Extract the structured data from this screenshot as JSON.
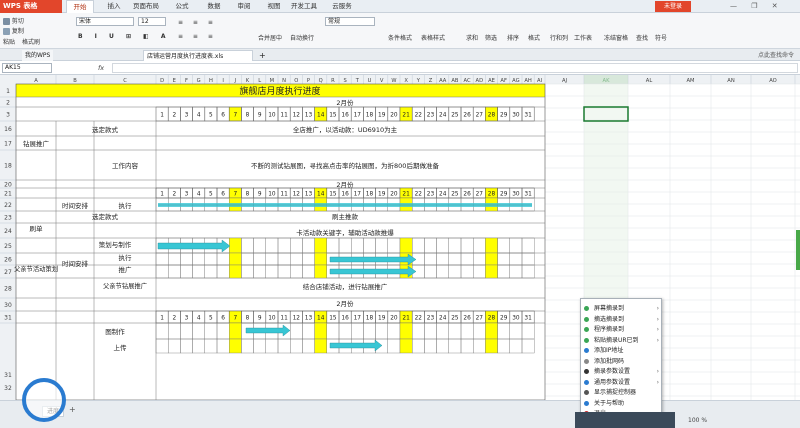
{
  "app": {
    "logo": "WPS 表格",
    "login": "未登录"
  },
  "menu_tabs": [
    "开始",
    "插入",
    "页面布局",
    "公式",
    "数据",
    "审阅",
    "视图",
    "开发工具",
    "云服务"
  ],
  "ribbon": {
    "cut": "剪切",
    "copy": "复制",
    "paste": "粘贴",
    "format_painter": "格式刷",
    "font": "宋体",
    "size": "12",
    "number_format": "常规",
    "merge": "合并居中",
    "wrap": "自动换行",
    "cond": "条件格式",
    "table_style": "表格样式",
    "sum": "求和",
    "filter": "筛选",
    "sort": "排序",
    "format": "格式",
    "rowcol": "行和列",
    "sheet": "工作表",
    "freeze": "冻结窗格",
    "find": "查找",
    "symbol": "符号"
  },
  "doctabs": {
    "home": "我的WPS",
    "file": "店铺运营月度执行进度表.xls",
    "hint": "点此查找命令"
  },
  "namebox": "AK15",
  "fx": "fx",
  "columns": [
    "A",
    "B",
    "C",
    "D",
    "E",
    "F",
    "G",
    "H",
    "I",
    "J",
    "K",
    "L",
    "M",
    "N",
    "O",
    "P",
    "Q",
    "R",
    "S",
    "T",
    "U",
    "V",
    "W",
    "X",
    "Y",
    "Z",
    "AA",
    "AB",
    "AC",
    "AD",
    "AE",
    "AF",
    "AG",
    "AH",
    "AI",
    "AJ",
    "AK",
    "AL",
    "AM",
    "AN",
    "AO"
  ],
  "rows": [
    "1",
    "2",
    "3",
    "16",
    "17",
    "18",
    "20",
    "21",
    "22",
    "23",
    "24",
    "25",
    "26",
    "27",
    "28",
    "30",
    "31",
    "32"
  ],
  "sheet": {
    "title": "旗舰店月度执行进度",
    "month": "2月份",
    "days": [
      "1",
      "2",
      "3",
      "4",
      "5",
      "6",
      "7",
      "8",
      "9",
      "10",
      "11",
      "12",
      "13",
      "14",
      "15",
      "16",
      "17",
      "18",
      "19",
      "20",
      "21",
      "22",
      "23",
      "24",
      "25",
      "26",
      "27",
      "28",
      "29",
      "30",
      "31"
    ],
    "highlight_days": [
      7,
      14,
      21,
      28
    ],
    "drill": "钻展推广",
    "select_style": "选定款式",
    "full_store": "全店推广，以活动款：UD6910为主",
    "work_content": "工作内容",
    "work_text": "不断的测试钻展图，寻找高点击率的钻展图，为折800后期做准备",
    "time_plan": "时间安排",
    "execute": "执行",
    "brush": "刷单",
    "brush_main": "刷主推款",
    "keyword": "卡活动款关键字，辅助活动款推爆",
    "plan_make": "策划与制作",
    "fathers": "父亲节活动策划",
    "exec2": "执行",
    "promote": "推广",
    "fathers_drill": "父亲节钻展推广",
    "combine": "结合店铺活动，进行钻展推广",
    "month2": "2月份",
    "img_make": "图制作",
    "upload": "上传"
  },
  "sheet_tab": "进度",
  "zoom": "100 %",
  "context_menu": [
    {
      "label": "屏幕摘录到",
      "color": "#3aa655",
      "sub": true
    },
    {
      "label": "摘选摘录到",
      "color": "#3aa655",
      "sub": true
    },
    {
      "label": "程序摘录到",
      "color": "#3aa655",
      "sub": true
    },
    {
      "label": "粘贴摘录UR已到",
      "color": "#3aa655",
      "sub": true
    },
    {
      "label": "添加IP地址",
      "color": "#2a7bd0",
      "sub": false
    },
    {
      "label": "添加批网码",
      "color": "#888888",
      "sub": false
    },
    {
      "label": "摘录参数设置",
      "color": "#333333",
      "sub": true
    },
    {
      "label": "通用参数设置",
      "color": "#2a7bd0",
      "sub": true
    },
    {
      "label": "显示捕捉控制器",
      "color": "#555555",
      "sub": false
    },
    {
      "label": "关于与帮助",
      "color": "#2a7bd0",
      "sub": false
    },
    {
      "label": "退出",
      "color": "#d03030",
      "sub": false
    }
  ],
  "colors": {
    "yellow": "#ffff00",
    "arrow": "#38c6d4",
    "accent": "#e2462b"
  }
}
